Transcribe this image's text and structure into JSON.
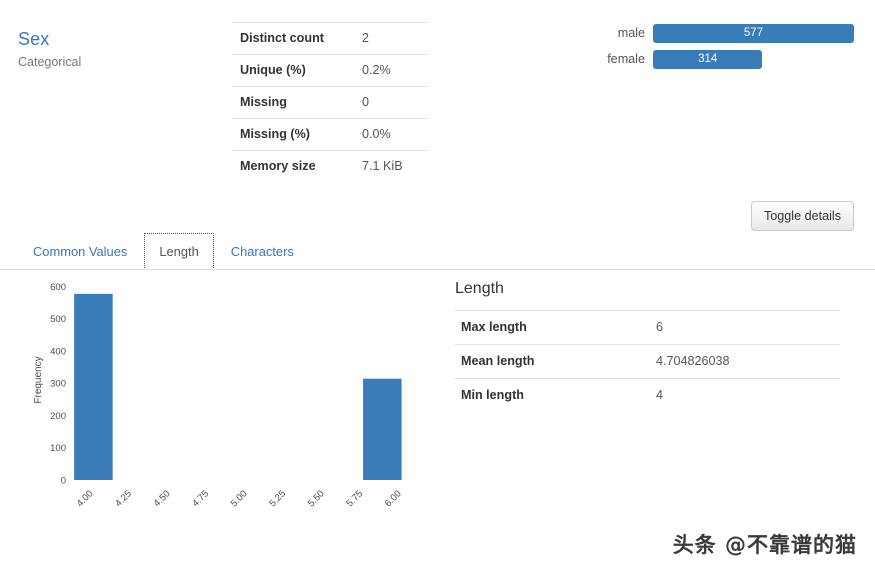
{
  "variable": {
    "name": "Sex",
    "type_label": "Categorical"
  },
  "stats": {
    "rows": [
      {
        "key": "Distinct count",
        "value": "2"
      },
      {
        "key": "Unique (%)",
        "value": "0.2%"
      },
      {
        "key": "Missing",
        "value": "0"
      },
      {
        "key": "Missing (%)",
        "value": "0.0%"
      },
      {
        "key": "Memory size",
        "value": "7.1 KiB"
      }
    ]
  },
  "frequency": {
    "rows": [
      {
        "label": "male",
        "value": "577",
        "count": 577,
        "pct": 100.0
      },
      {
        "label": "female",
        "value": "314",
        "count": 314,
        "pct": 54.4
      }
    ],
    "bar_color": "#3a7cb8"
  },
  "toggle": {
    "label": "Toggle details"
  },
  "tabs": [
    {
      "label": "Common Values",
      "active": false
    },
    {
      "label": "Length",
      "active": true
    },
    {
      "label": "Characters",
      "active": false
    }
  ],
  "length_panel": {
    "title": "Length",
    "rows": [
      {
        "key": "Max length",
        "value": "6"
      },
      {
        "key": "Mean length",
        "value": "4.704826038"
      },
      {
        "key": "Min length",
        "value": "4"
      }
    ]
  },
  "watermark": {
    "text": "头条 @不靠谱的猫"
  },
  "chart_data": {
    "type": "bar",
    "title": "",
    "xlabel": "",
    "ylabel": "Frequency",
    "x": [
      4.0,
      5.875
    ],
    "values": [
      577,
      314
    ],
    "bar_width": 0.25,
    "categories": [
      "4.00",
      "5.875"
    ],
    "xticks": [
      "4.00",
      "4.25",
      "4.50",
      "4.75",
      "5.00",
      "5.25",
      "5.50",
      "5.75",
      "6.00"
    ],
    "xtick_values": [
      4.0,
      4.25,
      4.5,
      4.75,
      5.0,
      5.25,
      5.5,
      5.75,
      6.0
    ],
    "yticks": [
      0,
      100,
      200,
      300,
      400,
      500,
      600
    ],
    "xlim": [
      3.9,
      6.1
    ],
    "ylim": [
      0,
      620
    ],
    "grid": false,
    "legend": "none",
    "bar_color": "#3a7cb8",
    "xtick_rotation": -45
  }
}
